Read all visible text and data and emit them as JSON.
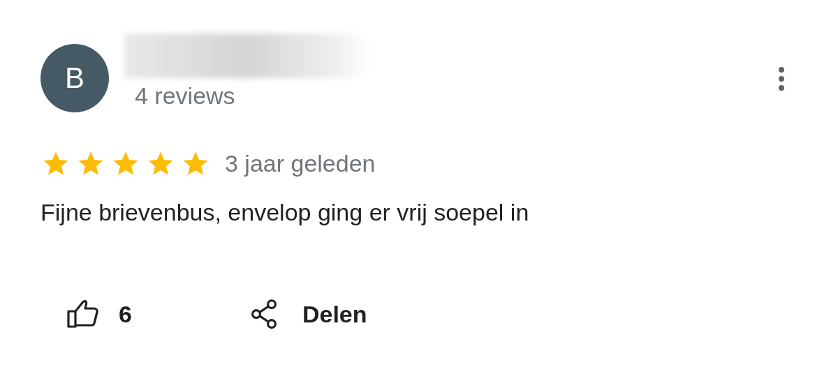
{
  "review": {
    "avatar_letter": "B",
    "author_redacted": true,
    "author_meta": "4 reviews",
    "stars": 5,
    "time": "3 jaar geleden",
    "text": "Fijne brievenbus, envelop ging er vrij soepel in"
  },
  "actions": [
    {
      "kind": "like",
      "label": "6"
    },
    {
      "kind": "share",
      "label": "Delen"
    }
  ]
}
